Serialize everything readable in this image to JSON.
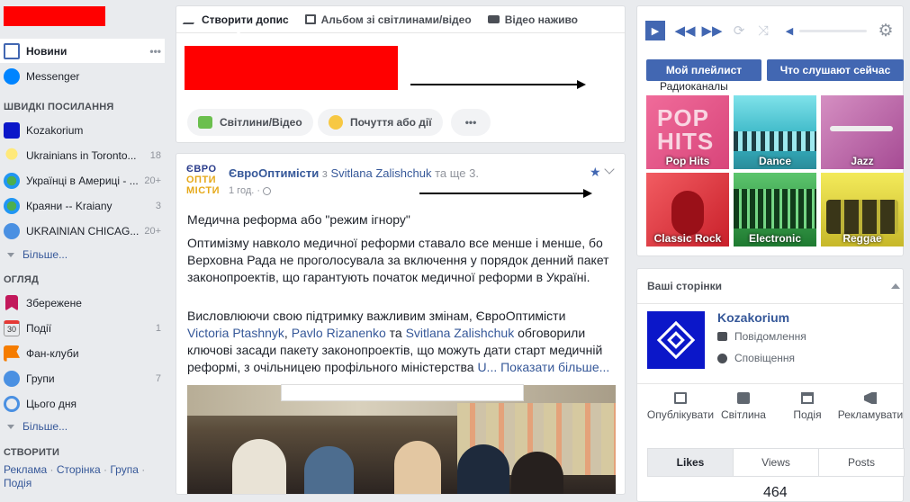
{
  "left": {
    "items": [
      {
        "label": "Новини",
        "count": "",
        "more": "•••"
      },
      {
        "label": "Messenger",
        "count": ""
      }
    ],
    "shortcuts_title": "ШВИДКІ ПОСИЛАННЯ",
    "shortcuts": [
      {
        "label": "Kozakorium",
        "count": ""
      },
      {
        "label": "Ukrainians in Toronto...",
        "count": "18"
      },
      {
        "label": "Українці в Америці - ...",
        "count": "20+"
      },
      {
        "label": "Краяни -- Kraiany",
        "count": "3"
      },
      {
        "label": "UKRAINIAN CHICAG...",
        "count": "20+"
      }
    ],
    "more1": "Більше...",
    "explore_title": "ОГЛЯД",
    "explore": [
      {
        "label": "Збережене",
        "count": ""
      },
      {
        "label": "Події",
        "count": "1",
        "icon_text": "30"
      },
      {
        "label": "Фан-клуби",
        "count": ""
      },
      {
        "label": "Групи",
        "count": "7"
      },
      {
        "label": "Цього дня",
        "count": ""
      }
    ],
    "more2": "Більше...",
    "create_title": "СТВОРИТИ",
    "create_links": [
      "Реклама",
      "Сторінка",
      "Група",
      "Подія"
    ]
  },
  "composer": {
    "tabs": [
      "Створити допис",
      "Альбом зі світлинами/відео",
      "Відео наживо"
    ],
    "photo_btn": "Світлини/Відео",
    "feeling_btn": "Почуття або дії",
    "more_btn": "•••"
  },
  "post": {
    "page_logo": "ЄВРО ОПТИ МІСТИ",
    "author": "ЄвроОптимісти",
    "with_word": "з",
    "with_user": "Svitlana Zalishchuk",
    "and_more": "та ще 3.",
    "time": "1 год.",
    "title": "Медична реформа або \"режим ігнору\"",
    "para1": "Оптимізму навколо медичної реформи ставало все менше і менше, бо Верховна Рада не проголосувала за включення у порядок денний пакет законопроектів, що гарантують початок медичної реформи в Україні.",
    "p2_a": "Висловлюючи свою підтримку важливим змінам, ЄвроОптимісти ",
    "p2_link1": "Victoria Ptashnyk",
    "p2_b": ", ",
    "p2_link2": "Pavlo Rizanenko",
    "p2_c": " та ",
    "p2_link3": "Svitlana Zalishchuk",
    "p2_d": " обговорили ключові засади пакету законопроектів, що можуть дати старт медичній реформі, з очільницею профільного міністерства ",
    "p2_link4": "U...",
    "show_more": "Показати більше..."
  },
  "player": {
    "btn_playlist": "Мой плейлист",
    "btn_listen": "Что слушают сейчас",
    "radio_title": "Радиоканалы",
    "channels": [
      "Pop Hits",
      "Dance",
      "Jazz",
      "Classic Rock",
      "Electronic",
      "Reggae"
    ],
    "pop_art": "POP HITS"
  },
  "pages": {
    "title": "Ваші сторінки",
    "page_name": "Kozakorium",
    "messages": "Повідомлення",
    "notifications": "Сповіщення",
    "actions": [
      "Опублікувати",
      "Світлина",
      "Подія",
      "Рекламувати"
    ],
    "stat_tabs": [
      "Likes",
      "Views",
      "Posts"
    ],
    "partial_count": "464"
  },
  "colors": {
    "accent": "#4267b2",
    "link": "#365899",
    "redact": "#ff0000"
  }
}
